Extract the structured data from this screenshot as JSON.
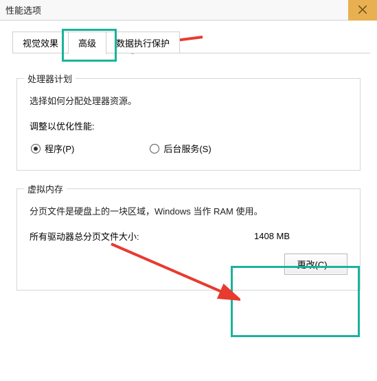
{
  "window": {
    "title": "性能选项"
  },
  "tabs": {
    "visual": "视觉效果",
    "advanced": "高级",
    "dep": "数据执行保护"
  },
  "processor": {
    "group_title": "处理器计划",
    "desc": "选择如何分配处理器资源。",
    "adjust_label": "调整以优化性能:",
    "opt_programs": "程序(P)",
    "opt_services": "后台服务(S)"
  },
  "vm": {
    "group_title": "虚拟内存",
    "desc": "分页文件是硬盘上的一块区域，Windows 当作 RAM 使用。",
    "total_label": "所有驱动器总分页文件大小:",
    "total_value": "1408 MB",
    "change_btn": "更改(C)..."
  }
}
